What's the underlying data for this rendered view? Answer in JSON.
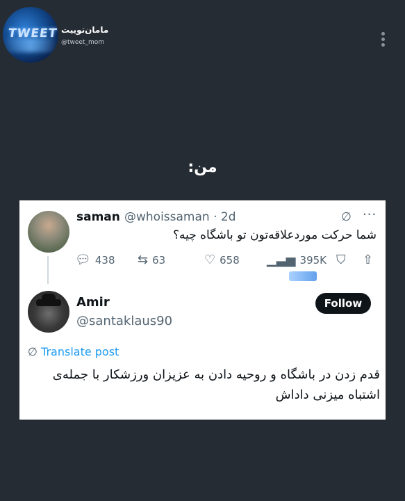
{
  "channel": {
    "name": "مامان‌توییت",
    "handle": "@tweet_mom",
    "logo_text": "TWEET"
  },
  "caption": "من:",
  "tweet1": {
    "author_name": "saman",
    "author_handle": "@whoissaman · 2d",
    "text": "شما حرکت موردعلاقه‌تون تو باشگاه چیه؟",
    "replies": "438",
    "retweets": "63",
    "likes": "658",
    "views": "395K"
  },
  "tweet2": {
    "author_name": "Amir",
    "author_handle": "@santaklaus90",
    "follow_label": "Follow",
    "translate_label": "Translate post",
    "text": "قدم زدن در باشگاه و روحیه دادن به عزیزان ورزشکار با جمله‌ی اشتباه میزنی داداش"
  },
  "icons": {
    "reply": "reply-icon",
    "retweet": "retweet-icon",
    "like": "heart-icon",
    "views": "views-icon",
    "bookmark": "bookmark-icon",
    "share": "share-icon",
    "grok": "grok-icon",
    "more": "more-icon",
    "translate": "globe-icon"
  },
  "colors": {
    "background": "#262c33",
    "card": "#ffffff",
    "text_primary": "#0f1419",
    "text_secondary": "#536471",
    "link": "#1d9bf0",
    "follow_button": "#0f1419"
  }
}
